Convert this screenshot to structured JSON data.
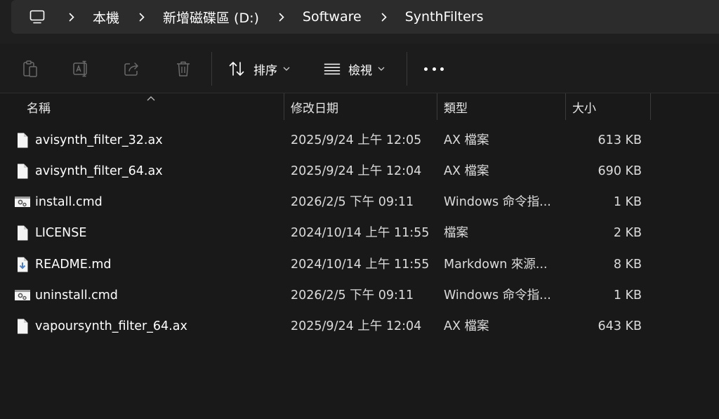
{
  "breadcrumb": {
    "items": [
      {
        "label": "本機"
      },
      {
        "label": "新增磁碟區 (D:)"
      },
      {
        "label": "Software"
      },
      {
        "label": "SynthFilters"
      }
    ]
  },
  "toolbar": {
    "icons": [
      "paste-icon",
      "rename-icon",
      "share-icon",
      "delete-icon"
    ],
    "sort_label": "排序",
    "view_label": "檢視"
  },
  "columns": {
    "name": "名稱",
    "date": "修改日期",
    "type": "類型",
    "size": "大小"
  },
  "files": [
    {
      "name": "avisynth_filter_32.ax",
      "date": "2025/9/24 上午 12:05",
      "type": "AX 檔案",
      "size": "613 KB",
      "icon": "document-icon"
    },
    {
      "name": "avisynth_filter_64.ax",
      "date": "2025/9/24 上午 12:04",
      "type": "AX 檔案",
      "size": "690 KB",
      "icon": "document-icon"
    },
    {
      "name": "install.cmd",
      "date": "2026/2/5 下午 09:11",
      "type": "Windows 命令指...",
      "size": "1 KB",
      "icon": "script-gear-icon"
    },
    {
      "name": "LICENSE",
      "date": "2024/10/14 上午 11:55",
      "type": "檔案",
      "size": "2 KB",
      "icon": "document-icon"
    },
    {
      "name": "README.md",
      "date": "2024/10/14 上午 11:55",
      "type": "Markdown 來源...",
      "size": "8 KB",
      "icon": "markdown-icon"
    },
    {
      "name": "uninstall.cmd",
      "date": "2026/2/5 下午 09:11",
      "type": "Windows 命令指...",
      "size": "1 KB",
      "icon": "script-gear-icon"
    },
    {
      "name": "vapoursynth_filter_64.ax",
      "date": "2025/9/24 上午 12:04",
      "type": "AX 檔案",
      "size": "643 KB",
      "icon": "document-icon"
    }
  ]
}
